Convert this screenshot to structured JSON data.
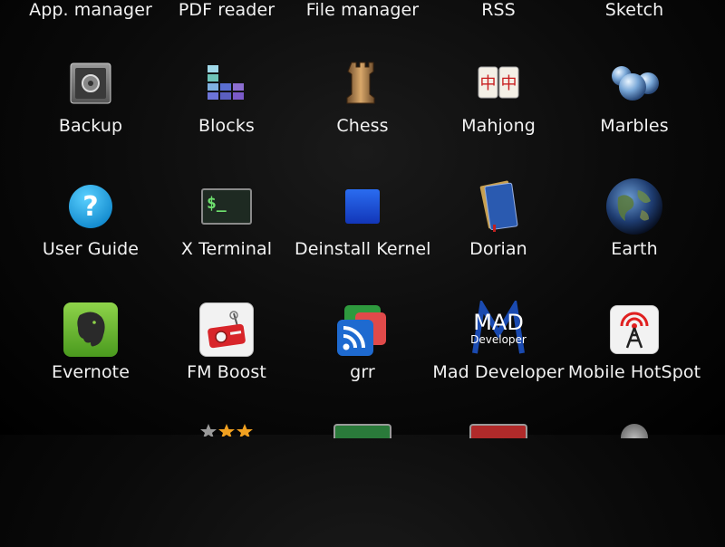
{
  "rows": [
    {
      "apps": [
        "App. manager",
        "PDF reader",
        "File manager",
        "RSS",
        "Sketch"
      ]
    },
    {
      "apps": [
        "Backup",
        "Blocks",
        "Chess",
        "Mahjong",
        "Marbles"
      ]
    },
    {
      "apps": [
        "User Guide",
        "X Terminal",
        "Deinstall Kernel-",
        "Dorian",
        "Earth"
      ]
    },
    {
      "apps": [
        "Evernote",
        "FM Boost",
        "grr",
        "Mad Developer",
        "Mobile HotSpot"
      ]
    }
  ],
  "icons": {
    "terminal_prompt": "$_",
    "mad_title": "MAD",
    "mad_subtitle": "Developer",
    "mahjong_tiles": "中中"
  }
}
